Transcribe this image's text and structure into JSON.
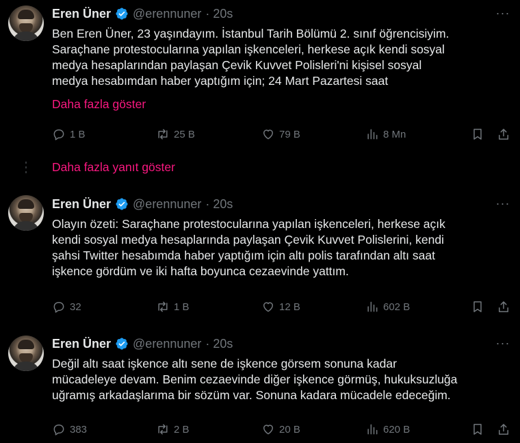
{
  "theme": {
    "background": "#000000",
    "text": "#e7e9ea",
    "muted": "#71767b",
    "accent_link": "#f91880",
    "verified": "#1d9bf0"
  },
  "more_replies_label": "Daha fazla yanıt göster",
  "tweets": [
    {
      "name": "Eren Üner",
      "handle": "@erennuner",
      "time": "· 20s",
      "text": "Ben Eren Üner, 23 yaşındayım. İstanbul Tarih Bölümü 2. sınıf öğrencisiyim.\nSaraçhane protestocularına yapılan işkenceleri, herkese açık kendi sosyal\nmedya hesaplarından paylaşan Çevik Kuvvet Polisleri'ni kişisel sosyal\nmedya hesabımdan haber yaptığım için; 24 Mart Pazartesi saat",
      "show_more": "Daha fazla göster",
      "replies": "1 B",
      "reposts": "25 B",
      "likes": "79 B",
      "views": "8 Mn"
    },
    {
      "name": "Eren Üner",
      "handle": "@erennuner",
      "time": "· 20s",
      "text": "Olayın özeti: Saraçhane protestocularına yapılan işkenceleri, herkese açık\nkendi sosyal medya hesaplarında paylaşan Çevik Kuvvet Polislerini, kendi\nşahsi Twitter hesabımda haber yaptığım için altı polis tarafından altı saat\nişkence gördüm ve iki hafta boyunca cezaevinde yattım.",
      "replies": "32",
      "reposts": "1 B",
      "likes": "12 B",
      "views": "602 B"
    },
    {
      "name": "Eren Üner",
      "handle": "@erennuner",
      "time": "· 20s",
      "text": "Değil altı saat işkence altı sene de işkence görsem sonuna kadar\nmücadeleye devam. Benim cezaevinde diğer işkence görmüş, hukuksuzluğa\nuğramış arkadaşlarıma bir sözüm var. Sonuna kadara mücadele edeceğim.",
      "replies": "383",
      "reposts": "2 B",
      "likes": "20 B",
      "views": "620 B"
    }
  ]
}
